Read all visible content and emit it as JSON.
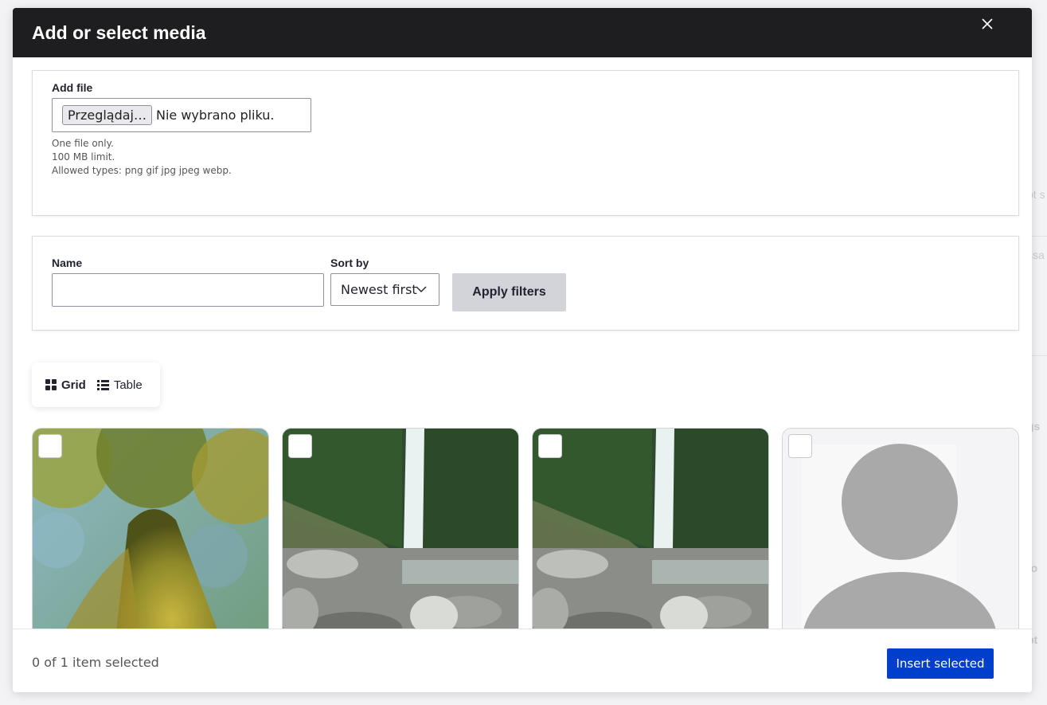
{
  "dialog": {
    "title": "Add or select media",
    "close_icon": "close-icon"
  },
  "upload": {
    "label": "Add file",
    "browse_button": "Przeglądaj…",
    "file_status": "Nie wybrano pliku.",
    "help": [
      "One file only.",
      "100 MB limit.",
      "Allowed types: png gif jpg jpeg webp."
    ]
  },
  "filters": {
    "name_label": "Name",
    "name_value": "",
    "sort_label": "Sort by",
    "sort_value": "Newest first",
    "apply_label": "Apply filters"
  },
  "view_toggle": {
    "grid_label": "Grid",
    "grid_icon": "grid-icon",
    "table_label": "Table",
    "table_icon": "list-icon",
    "active": "grid"
  },
  "media_items": [
    {
      "thumbnail": "tree-moss-photo",
      "selected": false
    },
    {
      "thumbnail": "waterfall-photo",
      "selected": false
    },
    {
      "thumbnail": "waterfall-photo",
      "selected": false
    },
    {
      "thumbnail": "generic-user-avatar",
      "selected": false
    }
  ],
  "footer": {
    "selection_count": "0 of 1 item selected",
    "insert_label": "Insert selected"
  },
  "colors": {
    "titlebar": "#1e1e20",
    "primary_button": "#003ecc",
    "secondary_button": "#d3d4d9"
  }
}
